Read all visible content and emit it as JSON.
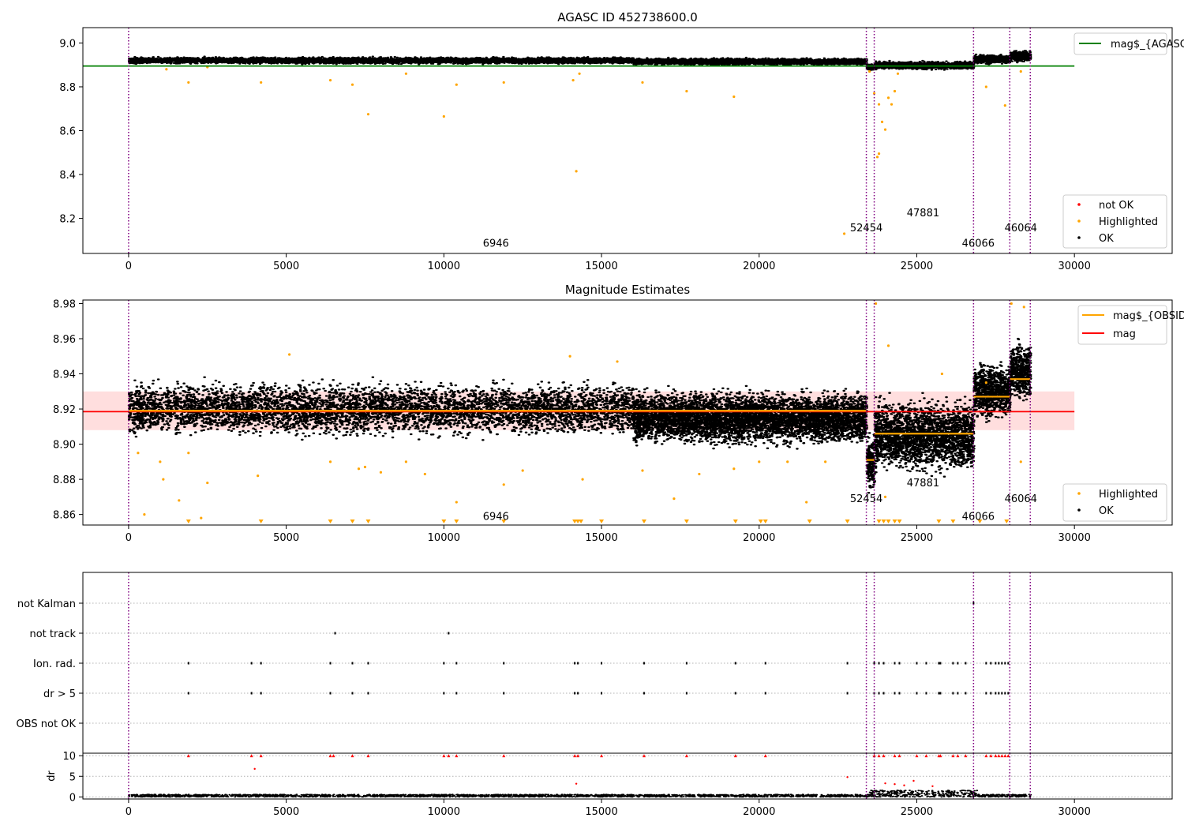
{
  "chart_data": [
    {
      "type": "scatter",
      "title": "AGASC ID 452738600.0",
      "xlabel": "",
      "ylabel": "",
      "xlim": [
        -1450,
        33100
      ],
      "ylim": [
        8.04,
        9.07
      ],
      "xticks": [
        0,
        5000,
        10000,
        15000,
        20000,
        25000,
        30000
      ],
      "xtick_labels": [
        "0",
        "5000",
        "10000",
        "15000",
        "20000",
        "25000",
        "30000"
      ],
      "yticks": [
        8.2,
        8.4,
        8.6,
        8.8,
        9.0
      ],
      "ytick_labels": [
        "8.2",
        "8.4",
        "8.6",
        "8.8",
        "9.0"
      ],
      "obsid_boundaries": [
        0,
        23400,
        23650,
        26800,
        27950,
        28600
      ],
      "obsid_labels": [
        {
          "text": "6946",
          "x": 11650,
          "y": 8.07
        },
        {
          "text": "52454",
          "x": 23400,
          "y": 8.14
        },
        {
          "text": "47881",
          "x": 25200,
          "y": 8.21
        },
        {
          "text": "46066",
          "x": 26950,
          "y": 8.07
        },
        {
          "text": "46064",
          "x": 28300,
          "y": 8.14
        }
      ],
      "agasc_mag_line": {
        "value": 8.895,
        "x_range": [
          -1450,
          30000
        ]
      },
      "ok_bands": [
        {
          "x_range": [
            0,
            16000
          ],
          "y_range": [
            8.905,
            8.935
          ]
        },
        {
          "x_range": [
            16000,
            23400
          ],
          "y_range": [
            8.9,
            8.93
          ]
        },
        {
          "x_range": [
            23400,
            23650
          ],
          "y_range": [
            8.875,
            8.905
          ]
        },
        {
          "x_range": [
            23650,
            26800
          ],
          "y_range": [
            8.88,
            8.915
          ]
        },
        {
          "x_range": [
            26800,
            27950
          ],
          "y_range": [
            8.905,
            8.945
          ]
        },
        {
          "x_range": [
            27950,
            28600
          ],
          "y_range": [
            8.915,
            8.965
          ]
        }
      ],
      "highlighted_points": [
        [
          1200,
          8.88
        ],
        [
          1900,
          8.82
        ],
        [
          2500,
          8.89
        ],
        [
          4200,
          8.82
        ],
        [
          6400,
          8.83
        ],
        [
          7100,
          8.81
        ],
        [
          7600,
          8.675
        ],
        [
          8800,
          8.86
        ],
        [
          10000,
          8.665
        ],
        [
          10400,
          8.81
        ],
        [
          11900,
          8.82
        ],
        [
          14100,
          8.83
        ],
        [
          14200,
          8.415
        ],
        [
          14300,
          8.86
        ],
        [
          16300,
          8.82
        ],
        [
          17700,
          8.78
        ],
        [
          19200,
          8.755
        ],
        [
          22700,
          8.13
        ],
        [
          23500,
          8.87
        ],
        [
          23650,
          8.77
        ],
        [
          23800,
          8.72
        ],
        [
          23900,
          8.64
        ],
        [
          24000,
          8.605
        ],
        [
          23800,
          8.495
        ],
        [
          23750,
          8.48
        ],
        [
          24100,
          8.75
        ],
        [
          24200,
          8.72
        ],
        [
          24300,
          8.78
        ],
        [
          24400,
          8.86
        ],
        [
          27200,
          8.8
        ],
        [
          27800,
          8.715
        ],
        [
          28300,
          8.87
        ]
      ],
      "series": [
        {
          "name": "mag$_{AGASC}$",
          "role": "line",
          "color": "#008000"
        },
        {
          "name": "not OK",
          "role": "marker",
          "color": "#ff0000"
        },
        {
          "name": "Highlighted",
          "role": "marker",
          "color": "#ffa500"
        },
        {
          "name": "OK",
          "role": "marker",
          "color": "#000000"
        }
      ],
      "legends": [
        "top-right",
        "bottom-right"
      ],
      "grid": false
    },
    {
      "type": "scatter",
      "title": "Magnitude Estimates",
      "xlabel": "",
      "ylabel": "",
      "xlim": [
        -1450,
        33100
      ],
      "ylim": [
        8.854,
        8.982
      ],
      "xticks": [
        0,
        5000,
        10000,
        15000,
        20000,
        25000,
        30000
      ],
      "xtick_labels": [
        "0",
        "5000",
        "10000",
        "15000",
        "20000",
        "25000",
        "30000"
      ],
      "yticks": [
        8.86,
        8.88,
        8.9,
        8.92,
        8.94,
        8.96,
        8.98
      ],
      "ytick_labels": [
        "8.86",
        "8.88",
        "8.90",
        "8.92",
        "8.94",
        "8.96",
        "8.98"
      ],
      "obsid_boundaries": [
        0,
        23400,
        23650,
        26800,
        27950,
        28600
      ],
      "obsid_labels": [
        {
          "text": "6946",
          "x": 11650,
          "y": 8.857
        },
        {
          "text": "52454",
          "x": 23400,
          "y": 8.867
        },
        {
          "text": "47881",
          "x": 25200,
          "y": 8.876
        },
        {
          "text": "46066",
          "x": 26950,
          "y": 8.857
        },
        {
          "text": "46064",
          "x": 28300,
          "y": 8.867
        }
      ],
      "mean_mag": {
        "value": 8.9185,
        "band": [
          8.908,
          8.93
        ],
        "x_range": [
          -1450,
          30000
        ]
      },
      "obsid_means": [
        {
          "x_range": [
            0,
            23400
          ],
          "value": 8.919
        },
        {
          "x_range": [
            23400,
            23650
          ],
          "value": 8.891
        },
        {
          "x_range": [
            23650,
            26800
          ],
          "value": 8.906
        },
        {
          "x_range": [
            26800,
            27950
          ],
          "value": 8.927
        },
        {
          "x_range": [
            27950,
            28600
          ],
          "value": 8.937
        }
      ],
      "ok_bands": [
        {
          "x_range": [
            0,
            16000
          ],
          "y_range": [
            8.905,
            8.935
          ]
        },
        {
          "x_range": [
            16000,
            23400
          ],
          "y_range": [
            8.9,
            8.93
          ]
        },
        {
          "x_range": [
            23400,
            23650
          ],
          "y_range": [
            8.872,
            8.905
          ]
        },
        {
          "x_range": [
            23650,
            26800
          ],
          "y_range": [
            8.885,
            8.925
          ]
        },
        {
          "x_range": [
            26800,
            27950
          ],
          "y_range": [
            8.915,
            8.945
          ]
        },
        {
          "x_range": [
            27950,
            28600
          ],
          "y_range": [
            8.925,
            8.958
          ]
        }
      ],
      "highlighted_points": [
        [
          300,
          8.895
        ],
        [
          500,
          8.86
        ],
        [
          1000,
          8.89
        ],
        [
          1100,
          8.88
        ],
        [
          1600,
          8.868
        ],
        [
          1900,
          8.895
        ],
        [
          2300,
          8.858
        ],
        [
          2500,
          8.878
        ],
        [
          4100,
          8.882
        ],
        [
          5100,
          8.951
        ],
        [
          6400,
          8.89
        ],
        [
          7300,
          8.886
        ],
        [
          7500,
          8.887
        ],
        [
          8000,
          8.884
        ],
        [
          8800,
          8.89
        ],
        [
          9400,
          8.883
        ],
        [
          10400,
          8.867
        ],
        [
          11900,
          8.877
        ],
        [
          12500,
          8.885
        ],
        [
          14000,
          8.95
        ],
        [
          14400,
          8.88
        ],
        [
          15500,
          8.947
        ],
        [
          16300,
          8.885
        ],
        [
          17300,
          8.869
        ],
        [
          18100,
          8.883
        ],
        [
          19200,
          8.886
        ],
        [
          20000,
          8.89
        ],
        [
          20900,
          8.89
        ],
        [
          21500,
          8.867
        ],
        [
          22100,
          8.89
        ],
        [
          23700,
          8.98
        ],
        [
          24000,
          8.87
        ],
        [
          24100,
          8.956
        ],
        [
          25800,
          8.94
        ],
        [
          27200,
          8.935
        ],
        [
          28000,
          8.98
        ],
        [
          28300,
          8.89
        ],
        [
          28400,
          8.978
        ]
      ],
      "clipped_low_points": [
        1900,
        4200,
        6400,
        7100,
        7600,
        10000,
        10400,
        11900,
        14150,
        14250,
        14350,
        15000,
        16350,
        17700,
        19250,
        20050,
        20200,
        21600,
        22800,
        23800,
        23950,
        24100,
        24300,
        24450,
        25700,
        26150,
        27000,
        27850
      ],
      "series": [
        {
          "name": "mag$_{OBSID}$",
          "role": "line",
          "color": "#ffa500"
        },
        {
          "name": "mag",
          "role": "line",
          "color": "#ff0000"
        },
        {
          "name": "Highlighted",
          "role": "marker",
          "color": "#ffa500"
        },
        {
          "name": "OK",
          "role": "marker",
          "color": "#000000"
        }
      ],
      "legends": [
        "top-right",
        "bottom-right"
      ],
      "grid": false
    },
    {
      "type": "scatter",
      "title": "",
      "xlabel": "",
      "ylabel": "",
      "xlim": [
        -1450,
        33100
      ],
      "categories": [
        "OBS not OK",
        "dr > 5",
        "Ion. rad.",
        "not track",
        "not Kalman"
      ],
      "flag_events": {
        "dr > 5": [
          1900,
          3900,
          4200,
          6400,
          7100,
          7600,
          10000,
          10400,
          11900,
          14150,
          14250,
          15000,
          16350,
          17700,
          19250,
          20200,
          22800,
          23650,
          23800,
          23950,
          24300,
          24450,
          25000,
          25300,
          25700,
          25750,
          26150,
          26300,
          26550,
          27200,
          27350,
          27500,
          27600,
          27700,
          27800,
          27900
        ],
        "Ion. rad.": [
          1900,
          3900,
          4200,
          6400,
          7100,
          7600,
          10000,
          10400,
          11900,
          14150,
          14250,
          15000,
          16350,
          17700,
          19250,
          20200,
          22800,
          23650,
          23800,
          23950,
          24300,
          24450,
          25000,
          25300,
          25700,
          25750,
          26150,
          26300,
          26550,
          27200,
          27350,
          27500,
          27600,
          27700,
          27800,
          27900
        ],
        "not track": [
          6550,
          10150
        ],
        "not Kalman": [
          26800
        ],
        "OBS not OK": []
      },
      "obsid_boundaries": [
        0,
        23400,
        23650,
        26800,
        27950,
        28600
      ],
      "grid": true
    },
    {
      "type": "scatter",
      "title": "",
      "xlabel": "",
      "ylabel": "dr",
      "xlim": [
        -1450,
        33100
      ],
      "ylim": [
        -0.5,
        10.6
      ],
      "xticks": [
        0,
        5000,
        10000,
        15000,
        20000,
        25000,
        30000
      ],
      "xtick_labels": [
        "0",
        "5000",
        "10000",
        "15000",
        "20000",
        "25000",
        "30000"
      ],
      "yticks": [
        0,
        5,
        10
      ],
      "ytick_labels": [
        "0",
        "5",
        "10"
      ],
      "clipped_points": [
        1900,
        3900,
        4200,
        6400,
        6500,
        7100,
        7600,
        10000,
        10150,
        10400,
        11900,
        14150,
        14250,
        15000,
        16350,
        17700,
        19250,
        20200,
        23650,
        23800,
        23950,
        24300,
        24450,
        25000,
        25300,
        25700,
        25750,
        26150,
        26300,
        26550,
        27200,
        27350,
        27500,
        27600,
        27700,
        27800,
        27900
      ],
      "red_points": [
        [
          4000,
          6.8
        ],
        [
          14200,
          3.2
        ],
        [
          22800,
          4.8
        ],
        [
          24000,
          3.3
        ],
        [
          24300,
          3.1
        ],
        [
          24600,
          2.8
        ],
        [
          24900,
          3.9
        ],
        [
          25500,
          2.6
        ]
      ],
      "obsid_boundaries": [
        0,
        23400,
        23650,
        26800,
        27950,
        28600
      ],
      "grid": true
    }
  ]
}
